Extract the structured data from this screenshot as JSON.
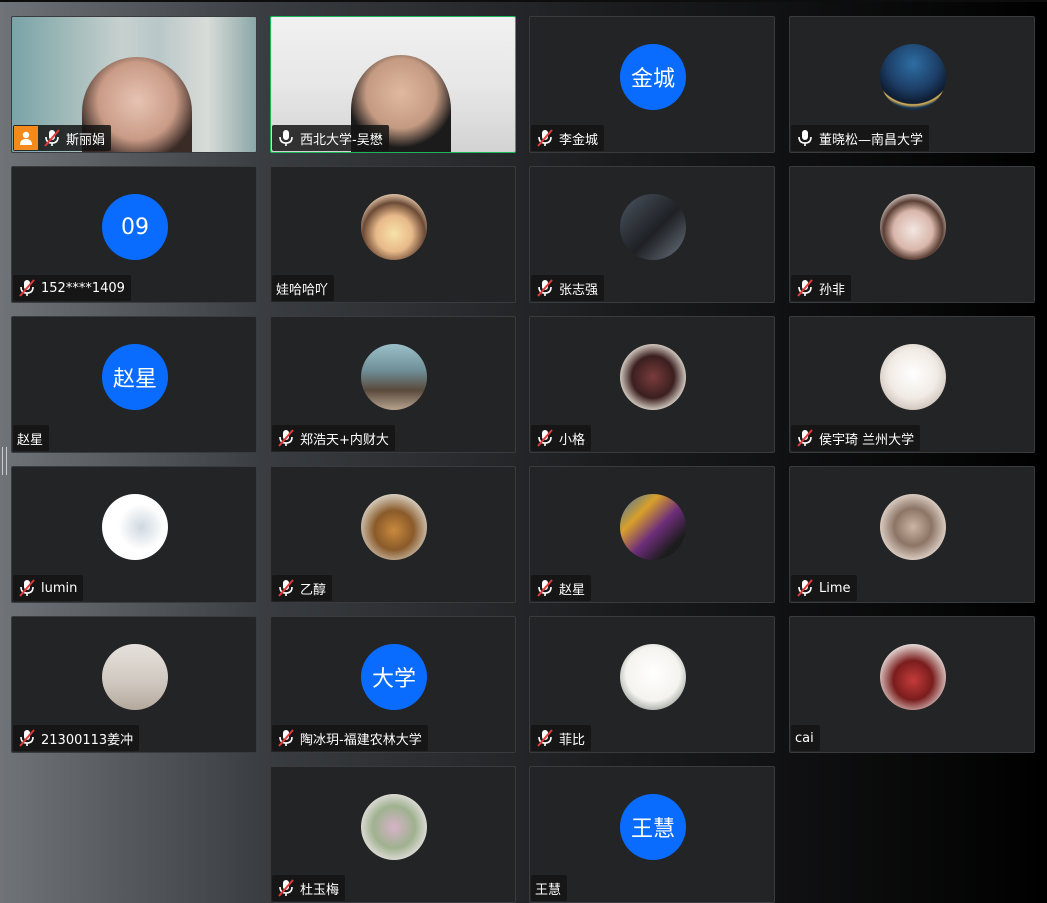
{
  "participants": [
    {
      "name": "斯丽娟",
      "avatar_type": "video",
      "avatar_text": "",
      "mic": "muted",
      "host": true,
      "active": false
    },
    {
      "name": "西北大学-吴懋",
      "avatar_type": "video",
      "avatar_text": "",
      "mic": "on",
      "host": false,
      "active": true
    },
    {
      "name": "李金城",
      "avatar_type": "text",
      "avatar_text": "金城",
      "mic": "muted",
      "host": false,
      "active": false
    },
    {
      "name": "董晓松—南昌大学",
      "avatar_type": "image",
      "avatar_text": "",
      "mic": "on",
      "host": false,
      "active": false
    },
    {
      "name": "152****1409",
      "avatar_type": "text",
      "avatar_text": "09",
      "mic": "muted",
      "host": false,
      "active": false
    },
    {
      "name": "娃哈哈吖",
      "avatar_type": "image",
      "avatar_text": "",
      "mic": "none",
      "host": false,
      "active": false
    },
    {
      "name": "张志强",
      "avatar_type": "image",
      "avatar_text": "",
      "mic": "muted",
      "host": false,
      "active": false
    },
    {
      "name": "孙非",
      "avatar_type": "image",
      "avatar_text": "",
      "mic": "muted",
      "host": false,
      "active": false
    },
    {
      "name": "赵星",
      "avatar_type": "text",
      "avatar_text": "赵星",
      "mic": "none",
      "host": false,
      "active": false
    },
    {
      "name": "郑浩天+内财大",
      "avatar_type": "image",
      "avatar_text": "",
      "mic": "muted",
      "host": false,
      "active": false
    },
    {
      "name": "小格",
      "avatar_type": "image",
      "avatar_text": "",
      "mic": "muted",
      "host": false,
      "active": false
    },
    {
      "name": "侯宇琦 兰州大学",
      "avatar_type": "image",
      "avatar_text": "",
      "mic": "muted",
      "host": false,
      "active": false
    },
    {
      "name": "lumin",
      "avatar_type": "image",
      "avatar_text": "",
      "mic": "muted",
      "host": false,
      "active": false
    },
    {
      "name": "乙醇",
      "avatar_type": "image",
      "avatar_text": "",
      "mic": "muted",
      "host": false,
      "active": false
    },
    {
      "name": "赵星",
      "avatar_type": "image",
      "avatar_text": "",
      "mic": "muted",
      "host": false,
      "active": false
    },
    {
      "name": "Lime",
      "avatar_type": "image",
      "avatar_text": "",
      "mic": "muted",
      "host": false,
      "active": false
    },
    {
      "name": "21300113姜冲",
      "avatar_type": "image",
      "avatar_text": "",
      "mic": "muted",
      "host": false,
      "active": false
    },
    {
      "name": "陶冰玥-福建农林大学",
      "avatar_type": "text",
      "avatar_text": "大学",
      "mic": "muted",
      "host": false,
      "active": false
    },
    {
      "name": "菲比",
      "avatar_type": "image",
      "avatar_text": "",
      "mic": "muted",
      "host": false,
      "active": false
    },
    {
      "name": "cai",
      "avatar_type": "image",
      "avatar_text": "",
      "mic": "none",
      "host": false,
      "active": false
    },
    {
      "name": "杜玉梅",
      "avatar_type": "image",
      "avatar_text": "",
      "mic": "muted",
      "host": false,
      "active": false
    },
    {
      "name": "王慧",
      "avatar_type": "text",
      "avatar_text": "王慧",
      "mic": "none",
      "host": false,
      "active": false
    }
  ],
  "colors": {
    "tile_bg": "#232426",
    "avatar_blue": "#0a6cff",
    "active_border": "#1fb35b",
    "host_badge": "#f48a1b"
  },
  "icons": {
    "muted": "mic-muted-icon",
    "on": "mic-icon",
    "host": "host-icon"
  }
}
